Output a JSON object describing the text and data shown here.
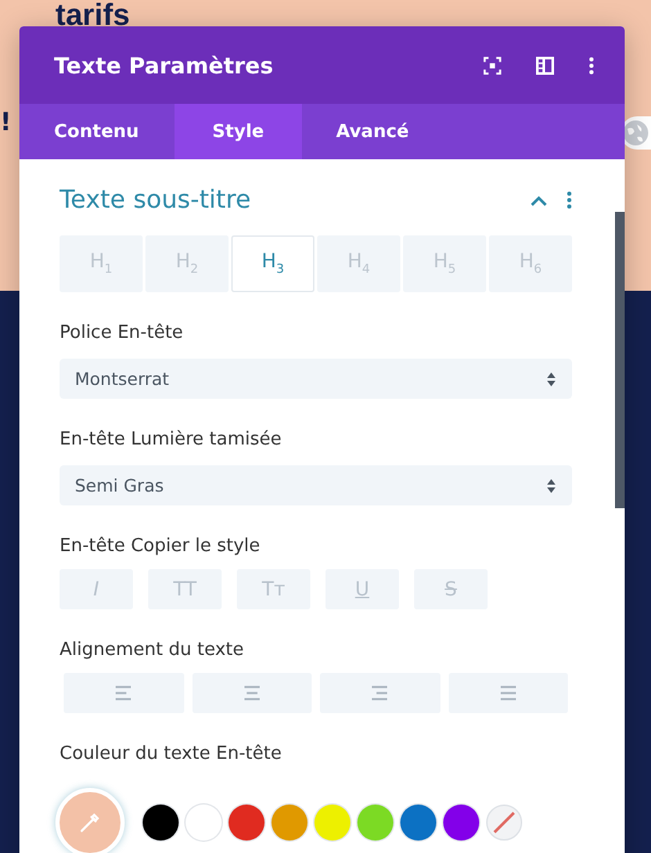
{
  "background": {
    "heading": "tarifs",
    "side_texts": [
      "!"
    ]
  },
  "window": {
    "title": "Texte Paramètres"
  },
  "tabs": [
    {
      "label": "Contenu",
      "selected": false
    },
    {
      "label": "Style",
      "selected": true
    },
    {
      "label": "Avancé",
      "selected": false
    }
  ],
  "section": {
    "title": "Texte sous-titre",
    "expanded": true
  },
  "heading_levels": [
    {
      "label": "H$_{1}$",
      "selected": false
    },
    {
      "label": "H$_{2}$",
      "selected": false
    },
    {
      "label": "H$_{3}$",
      "selected": true
    },
    {
      "label": "H$_{4}$",
      "selected": false
    },
    {
      "label": "H$_{5}$",
      "selected": false
    },
    {
      "label": "H$_{6}$",
      "selected": false
    }
  ],
  "font": {
    "label": "Police En-tête",
    "value": "Montserrat"
  },
  "weight": {
    "label": "En-tête Lumière tamisée",
    "value": "Semi Gras"
  },
  "style": {
    "label": "En-tête Copier le style",
    "options": [
      {
        "kind": "italic",
        "text": "I"
      },
      {
        "kind": "caps",
        "text": "TT"
      },
      {
        "kind": "smallcaps",
        "text": "Tт"
      },
      {
        "kind": "underline",
        "text": "U"
      },
      {
        "kind": "strike",
        "text": "S"
      }
    ]
  },
  "alignment": {
    "label": "Alignement du texte",
    "options": [
      {
        "kind": "left"
      },
      {
        "kind": "center"
      },
      {
        "kind": "right"
      },
      {
        "kind": "justify"
      }
    ]
  },
  "text_color": {
    "label": "Couleur du texte En-tête",
    "swatches": [
      {
        "kind": "picker",
        "color": "#f3c1a7"
      },
      {
        "color": "#000000"
      },
      {
        "color": "#ffffff"
      },
      {
        "color": "#e02b20"
      },
      {
        "color": "#e09900"
      },
      {
        "color": "#edf000"
      },
      {
        "color": "#7cda24"
      },
      {
        "color": "#0c71c3"
      },
      {
        "color": "#8300e9"
      },
      {
        "kind": "none"
      }
    ]
  }
}
